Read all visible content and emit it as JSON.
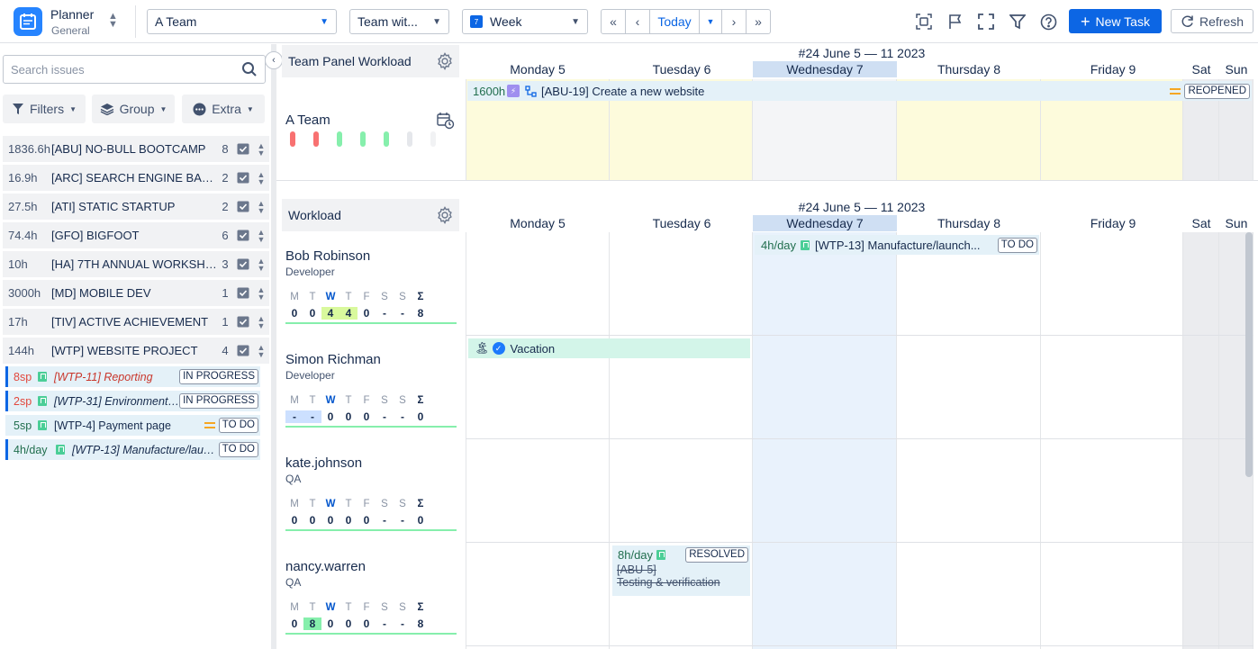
{
  "app": {
    "title": "Planner",
    "subtitle": "General"
  },
  "toolbar": {
    "team_select": "A Team",
    "view_select": "Team wit...",
    "period_select": "Week",
    "period_icon_number": "7",
    "today_label": "Today",
    "new_task_label": "New Task",
    "refresh_label": "Refresh"
  },
  "sidebar": {
    "search_placeholder": "Search issues",
    "filters_label": "Filters",
    "group_label": "Group",
    "extra_label": "Extra",
    "projects": [
      {
        "hours": "1836.6h",
        "name": "[ABU] NO-BULL BOOTCAMP",
        "count": "8"
      },
      {
        "hours": "16.9h",
        "name": "[ARC] SEARCH ENGINE BANDWAGON",
        "count": "2"
      },
      {
        "hours": "27.5h",
        "name": "[ATI] STATIC STARTUP",
        "count": "2"
      },
      {
        "hours": "74.4h",
        "name": "[GFO] BIGFOOT",
        "count": "6"
      },
      {
        "hours": "10h",
        "name": "[HA] 7TH ANNUAL WORKSHOP",
        "count": "3"
      },
      {
        "hours": "3000h",
        "name": "[MD] MOBILE DEV",
        "count": "1"
      },
      {
        "hours": "17h",
        "name": "[TIV] ACTIVE ACHIEVEMENT",
        "count": "1"
      },
      {
        "hours": "144h",
        "name": "[WTP] WEBSITE PROJECT",
        "count": "4"
      }
    ],
    "tasks": [
      {
        "estimate": "8sp",
        "title": "[WTP-11] Reporting",
        "status": "IN PROGRESS"
      },
      {
        "estimate": "2sp",
        "title": "[WTP-31] Environment setup",
        "status": "IN PROGRESS"
      },
      {
        "estimate": "5sp",
        "title": "[WTP-4] Payment page",
        "status": "TO DO"
      },
      {
        "estimate": "4h/day",
        "title": "[WTP-13] Manufacture/launch",
        "status": "TO DO"
      }
    ]
  },
  "team_panel": {
    "title": "Team Panel Workload",
    "week_title": "#24 June 5 — 11 2023",
    "team_name": "A Team",
    "days": [
      "Monday 5",
      "Tuesday 6",
      "Wednesday 7",
      "Thursday 8",
      "Friday 9",
      "Sat",
      "Sun"
    ],
    "event": {
      "hours": "1600h",
      "title": "[ABU-19] Create a new website",
      "status": "REOPENED"
    }
  },
  "workload": {
    "title": "Workload",
    "week_title": "#24 June 5 — 11 2023",
    "days": [
      "Monday 5",
      "Tuesday 6",
      "Wednesday 7",
      "Thursday 8",
      "Friday 9",
      "Sat",
      "Sun"
    ],
    "weekday_letters": [
      "M",
      "T",
      "W",
      "T",
      "F",
      "S",
      "S",
      "Σ"
    ],
    "members": [
      {
        "name": "Bob Robinson",
        "role": "Developer",
        "values": [
          "0",
          "0",
          "4",
          "4",
          "0",
          "-",
          "-",
          "8"
        ]
      },
      {
        "name": "Simon Richman",
        "role": "Developer",
        "values": [
          "-",
          "-",
          "0",
          "0",
          "0",
          "-",
          "-",
          "0"
        ]
      },
      {
        "name": "kate.johnson",
        "role": "QA",
        "values": [
          "0",
          "0",
          "0",
          "0",
          "0",
          "-",
          "-",
          "0"
        ]
      },
      {
        "name": "nancy.warren",
        "role": "QA",
        "values": [
          "0",
          "8",
          "0",
          "0",
          "0",
          "-",
          "-",
          "8"
        ]
      }
    ],
    "events": {
      "bob": {
        "hours": "4h/day",
        "title": "[WTP-13] Manufacture/launch...",
        "status": "TO DO"
      },
      "simon": {
        "title": "Vacation"
      },
      "nancy": {
        "hours": "8h/day",
        "key": "[ABU-5]",
        "title": "Testing & verification",
        "status": "RESOLVED"
      }
    }
  },
  "colors": {
    "accent": "#0c66e4",
    "today_column": "#e9f2fc",
    "workday_bg": "#fdfbdc",
    "weekend_bg": "#ebecef",
    "vacation_bg": "#d3f5e9"
  }
}
